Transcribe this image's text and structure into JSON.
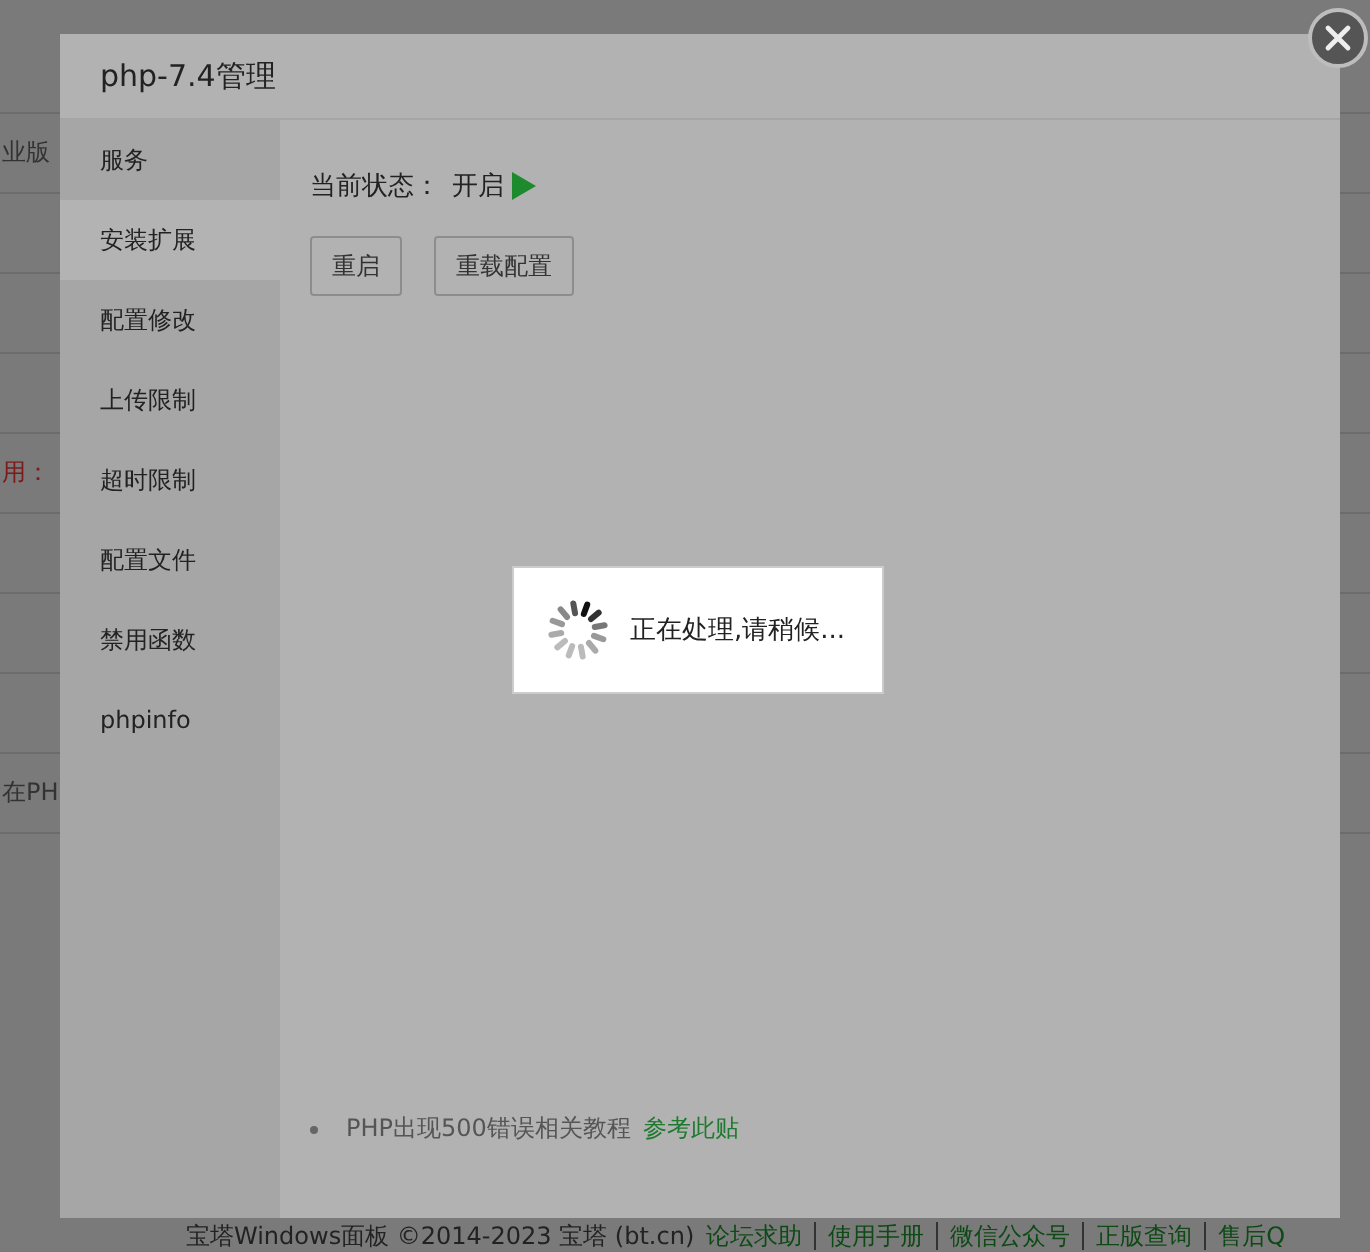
{
  "background": {
    "rows": [
      {
        "text": "",
        "kind": "blank"
      },
      {
        "text": "业版",
        "kind": "normal"
      },
      {
        "text": "",
        "kind": "blank"
      },
      {
        "text": "",
        "kind": "blank"
      },
      {
        "text": "",
        "kind": "blank"
      },
      {
        "text": "用：",
        "kind": "alert"
      },
      {
        "text": "",
        "kind": "blank"
      },
      {
        "text": "",
        "kind": "blank"
      },
      {
        "text": "",
        "kind": "blank"
      },
      {
        "text": "在PH",
        "kind": "normal"
      }
    ],
    "footer": {
      "copyright": "宝塔Windows面板 ©2014-2023 宝塔 (bt.cn)",
      "links": [
        "论坛求助",
        "使用手册",
        "微信公众号",
        "正版查询",
        "售后Q"
      ]
    }
  },
  "dialog": {
    "title": "php-7.4管理",
    "menu": [
      {
        "label": "服务",
        "selected": false
      },
      {
        "label": "安装扩展",
        "selected": true
      },
      {
        "label": "配置修改",
        "selected": false
      },
      {
        "label": "上传限制",
        "selected": false
      },
      {
        "label": "超时限制",
        "selected": false
      },
      {
        "label": "配置文件",
        "selected": false
      },
      {
        "label": "禁用函数",
        "selected": false
      },
      {
        "label": "phpinfo",
        "selected": false
      }
    ],
    "status_label": "当前状态：",
    "status_value": "开启",
    "running": true,
    "buttons": [
      "重启",
      "重载配置"
    ],
    "tips": [
      {
        "text": "PHP出现500错误相关教程",
        "link": "参考此贴"
      }
    ]
  },
  "loading": {
    "text": "正在处理,请稍候..."
  }
}
